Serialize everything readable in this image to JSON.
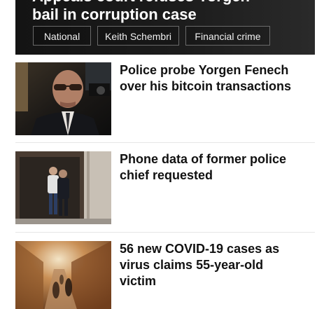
{
  "featured": {
    "title_line1": "Appeals court refuses Yorgen",
    "title_line2": "bail in corruption case",
    "tags": [
      "National",
      "Keith Schembri",
      "Financial crime"
    ]
  },
  "news": [
    {
      "headline": "Police probe Yorgen Fenech over his bitcoin transactions"
    },
    {
      "headline": "Phone data of former police chief requested"
    },
    {
      "headline": "56 new COVID-19 cases as virus claims 55-year-old victim"
    }
  ]
}
